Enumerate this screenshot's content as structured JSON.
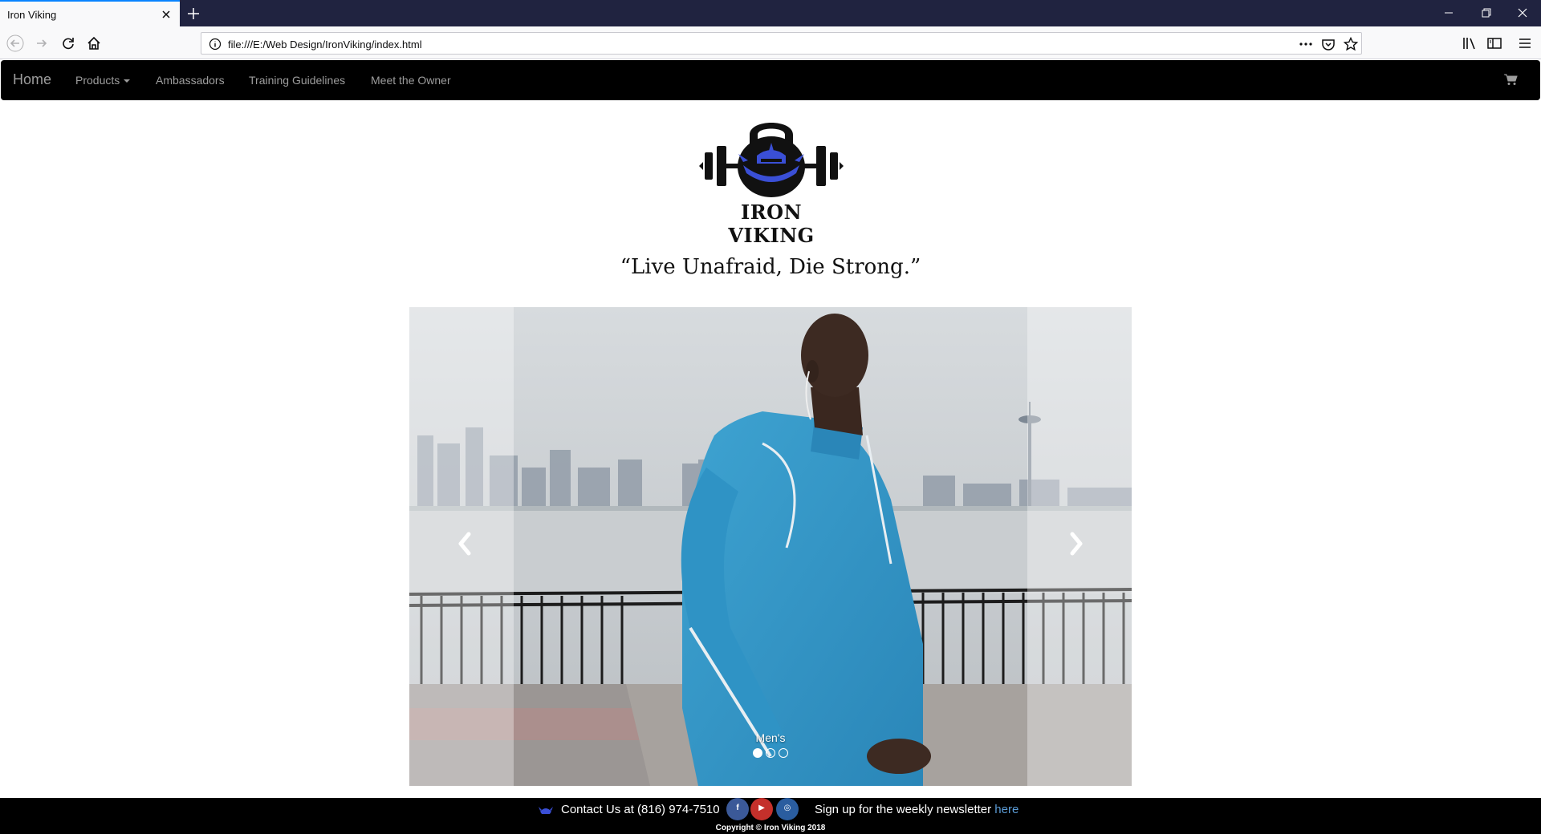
{
  "browser": {
    "tab_title": "Iron Viking",
    "url": "file:///E:/Web Design/IronViking/index.html",
    "icons": [
      "close-icon",
      "plus-icon",
      "minimize-icon",
      "restore-icon",
      "close-window-icon",
      "back-icon",
      "forward-icon",
      "reload-icon",
      "home-icon",
      "info-icon",
      "more-icon",
      "pocket-icon",
      "star-icon",
      "library-icon",
      "sidebar-icon",
      "menu-icon"
    ]
  },
  "site_nav": {
    "brand": "Home",
    "items": [
      {
        "label": "Products"
      },
      {
        "label": "Ambassadors"
      },
      {
        "label": "Training Guidelines"
      },
      {
        "label": "Meet the Owner"
      }
    ],
    "cart_icon": "cart-icon"
  },
  "logo": {
    "text": "IRON VIKING",
    "accent_color": "#3a4fd6"
  },
  "tagline": "“Live Unafraid, Die Strong.”",
  "carousel": {
    "caption": "Men's",
    "slide_count": 3,
    "active_index": 0
  },
  "footer": {
    "contact": "Contact Us at (816) 974-7510",
    "social": [
      {
        "name": "facebook",
        "glyph": "f",
        "color": "#3b5998"
      },
      {
        "name": "youtube",
        "glyph": "▶",
        "color": "#c4302b"
      },
      {
        "name": "instagram",
        "glyph": "◎",
        "color": "#2a5d9f"
      }
    ],
    "newsletter_text": "Sign up for the weekly newsletter ",
    "newsletter_link": "here",
    "copyright": "Copyright © Iron Viking 2018"
  }
}
